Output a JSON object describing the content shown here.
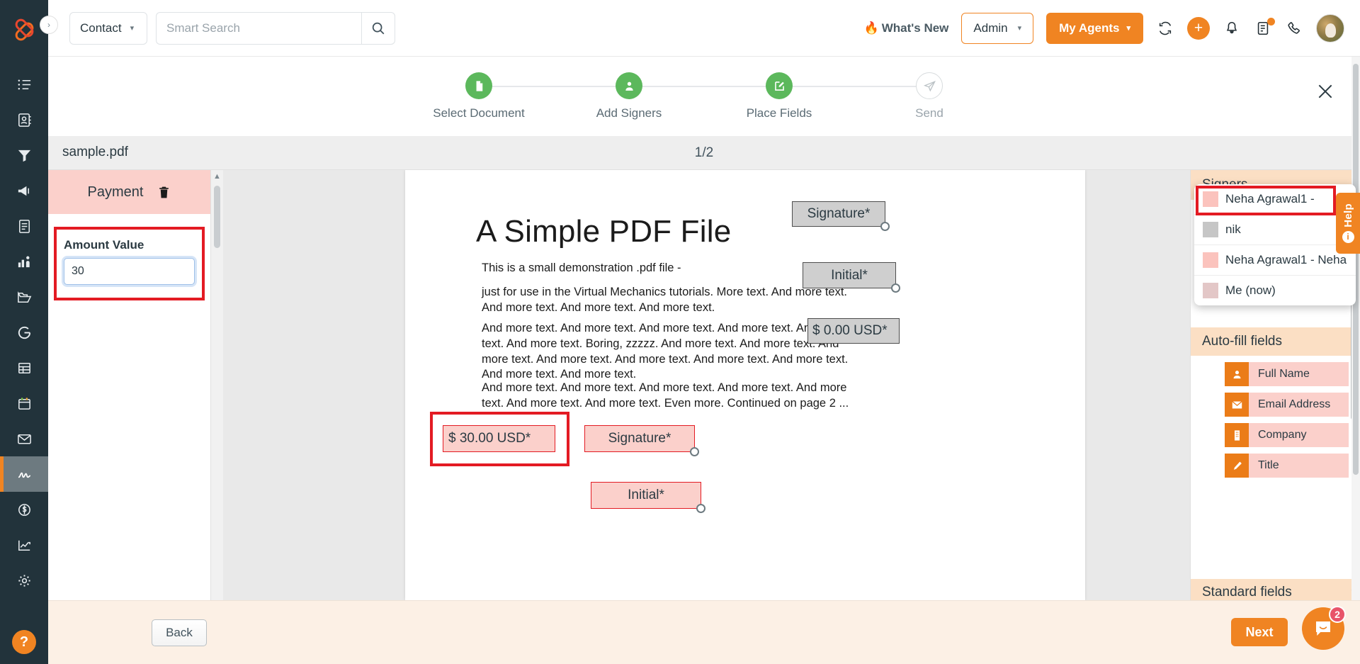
{
  "header": {
    "contact_label": "Contact",
    "search_placeholder": "Smart Search",
    "search_value": "",
    "whats_new": "What's New",
    "whats_new_icon": "fire-icon",
    "admin_label": "Admin",
    "my_agents_label": "My Agents",
    "icons": [
      "refresh-icon",
      "plus-icon",
      "bell-icon",
      "tasks-icon",
      "phone-icon",
      "avatar"
    ]
  },
  "stepper": {
    "steps": [
      {
        "label": "Select Document",
        "state": "done",
        "icon": "document-icon"
      },
      {
        "label": "Add Signers",
        "state": "done",
        "icon": "user-icon"
      },
      {
        "label": "Place Fields",
        "state": "done",
        "icon": "edit-square-icon"
      },
      {
        "label": "Send",
        "state": "pending",
        "icon": "send-icon"
      }
    ],
    "close_icon": "close-icon"
  },
  "filebar": {
    "filename": "sample.pdf",
    "page_indicator": "1/2"
  },
  "payment_panel": {
    "title": "Payment",
    "delete_icon": "trash-icon",
    "amount_label": "Amount Value",
    "amount_value": "30",
    "amount_placeholder": ""
  },
  "document": {
    "title": "A Simple PDF File",
    "paragraphs": [
      "This is a small demonstration .pdf file -",
      "just for use in the Virtual Mechanics tutorials. More text. And more text. And more text. And more text. And more text.",
      "And more text. And more text. And more text. And more text. And more text. And more text. Boring, zzzzz. And more text. And more text. And more text. And more text. And more text. And more text. And more text. And more text. And more text.",
      "And more text. And more text. And more text. And more text. And more text. And more text. And more text. Even more. Continued on page 2 ..."
    ],
    "fields": [
      {
        "label": "Signature*",
        "color": "gray",
        "name": "field-signature-gray"
      },
      {
        "label": "Initial*",
        "color": "gray",
        "name": "field-initial-gray"
      },
      {
        "label": "$ 0.00 USD*",
        "color": "gray",
        "name": "field-payment-zero"
      },
      {
        "label": "$ 30.00 USD*",
        "color": "pink",
        "name": "field-payment-selected"
      },
      {
        "label": "Signature*",
        "color": "pink",
        "name": "field-signature-pink"
      },
      {
        "label": "Initial*",
        "color": "pink",
        "name": "field-initial-pink"
      }
    ]
  },
  "signers_panel": {
    "title": "Signers",
    "selected": "Neha Agrawal1 -",
    "selected_swatch": "#fbc3bd",
    "options": [
      {
        "label": "nik",
        "swatch": "#c6c6c6"
      },
      {
        "label": "Neha Agrawal1 - Neha",
        "swatch": "#fbc3bd"
      },
      {
        "label": "Me (now)",
        "swatch": "#e3c7c7"
      }
    ],
    "chevron": "chevron-up-icon"
  },
  "autofill_panel": {
    "title": "Auto-fill fields",
    "items": [
      {
        "label": "Full Name",
        "icon": "user-icon"
      },
      {
        "label": "Email Address",
        "icon": "envelope-icon"
      },
      {
        "label": "Company",
        "icon": "building-icon"
      },
      {
        "label": "Title",
        "icon": "pen-icon"
      }
    ]
  },
  "standard_panel": {
    "title": "Standard fields"
  },
  "help_tab": {
    "label": "Help",
    "icon": "info-icon"
  },
  "footer": {
    "back_label": "Back",
    "next_label": "Next",
    "chat_badge": "2",
    "chat_icon": "chat-icon"
  },
  "rail": {
    "expand_icon": "chevron-right-icon",
    "items": [
      {
        "name": "list-icon"
      },
      {
        "name": "contacts-icon"
      },
      {
        "name": "funnel-icon"
      },
      {
        "name": "megaphone-icon"
      },
      {
        "name": "form-icon"
      },
      {
        "name": "reports-icon"
      },
      {
        "name": "folder-icon"
      },
      {
        "name": "google-icon"
      },
      {
        "name": "table-icon"
      },
      {
        "name": "calendar-icon"
      },
      {
        "name": "mail-icon"
      },
      {
        "name": "signature-icon"
      },
      {
        "name": "dollar-icon"
      },
      {
        "name": "analytics-icon"
      },
      {
        "name": "gear-icon"
      }
    ],
    "help_label": "?"
  },
  "colors": {
    "brand_orange": "#f08422",
    "dark_navy": "#22333b",
    "step_green": "#5cb85c",
    "highlight_red": "#e31b23",
    "pink_field": "#fbd0cb"
  }
}
